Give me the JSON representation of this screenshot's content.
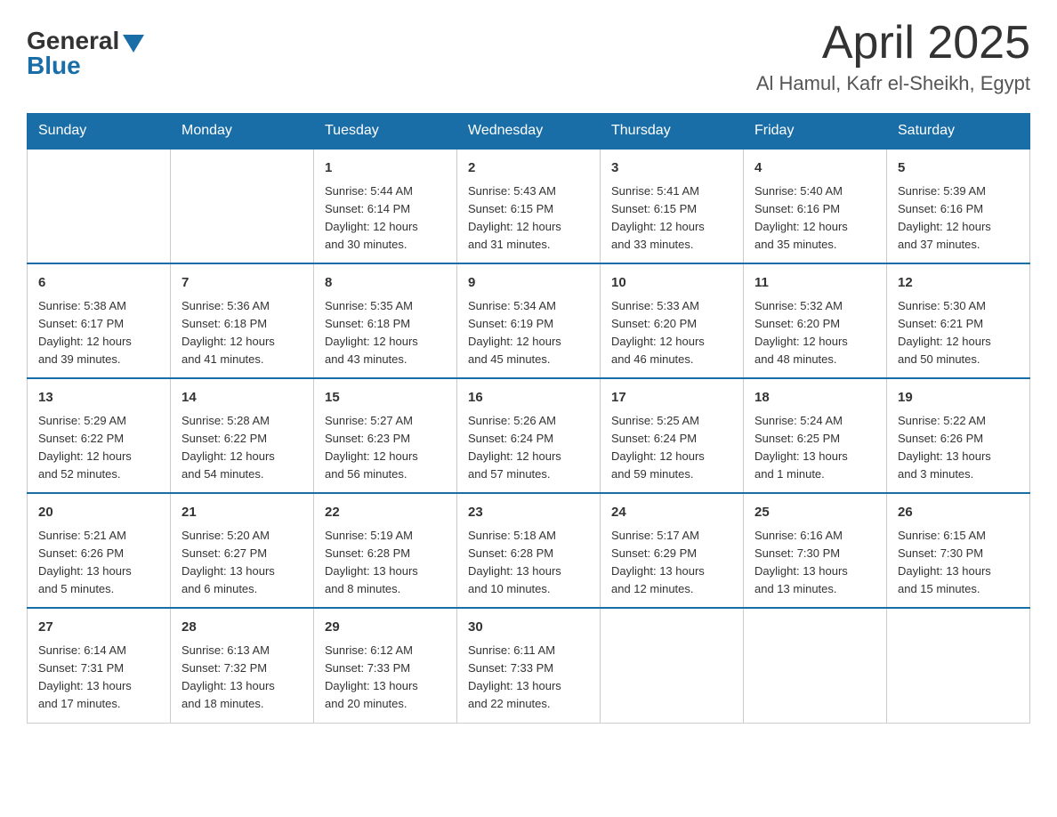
{
  "header": {
    "logo": {
      "general": "General",
      "blue": "Blue"
    },
    "title": "April 2025",
    "subtitle": "Al Hamul, Kafr el-Sheikh, Egypt"
  },
  "calendar": {
    "days_of_week": [
      "Sunday",
      "Monday",
      "Tuesday",
      "Wednesday",
      "Thursday",
      "Friday",
      "Saturday"
    ],
    "weeks": [
      [
        {
          "day": "",
          "info": ""
        },
        {
          "day": "",
          "info": ""
        },
        {
          "day": "1",
          "info": "Sunrise: 5:44 AM\nSunset: 6:14 PM\nDaylight: 12 hours\nand 30 minutes."
        },
        {
          "day": "2",
          "info": "Sunrise: 5:43 AM\nSunset: 6:15 PM\nDaylight: 12 hours\nand 31 minutes."
        },
        {
          "day": "3",
          "info": "Sunrise: 5:41 AM\nSunset: 6:15 PM\nDaylight: 12 hours\nand 33 minutes."
        },
        {
          "day": "4",
          "info": "Sunrise: 5:40 AM\nSunset: 6:16 PM\nDaylight: 12 hours\nand 35 minutes."
        },
        {
          "day": "5",
          "info": "Sunrise: 5:39 AM\nSunset: 6:16 PM\nDaylight: 12 hours\nand 37 minutes."
        }
      ],
      [
        {
          "day": "6",
          "info": "Sunrise: 5:38 AM\nSunset: 6:17 PM\nDaylight: 12 hours\nand 39 minutes."
        },
        {
          "day": "7",
          "info": "Sunrise: 5:36 AM\nSunset: 6:18 PM\nDaylight: 12 hours\nand 41 minutes."
        },
        {
          "day": "8",
          "info": "Sunrise: 5:35 AM\nSunset: 6:18 PM\nDaylight: 12 hours\nand 43 minutes."
        },
        {
          "day": "9",
          "info": "Sunrise: 5:34 AM\nSunset: 6:19 PM\nDaylight: 12 hours\nand 45 minutes."
        },
        {
          "day": "10",
          "info": "Sunrise: 5:33 AM\nSunset: 6:20 PM\nDaylight: 12 hours\nand 46 minutes."
        },
        {
          "day": "11",
          "info": "Sunrise: 5:32 AM\nSunset: 6:20 PM\nDaylight: 12 hours\nand 48 minutes."
        },
        {
          "day": "12",
          "info": "Sunrise: 5:30 AM\nSunset: 6:21 PM\nDaylight: 12 hours\nand 50 minutes."
        }
      ],
      [
        {
          "day": "13",
          "info": "Sunrise: 5:29 AM\nSunset: 6:22 PM\nDaylight: 12 hours\nand 52 minutes."
        },
        {
          "day": "14",
          "info": "Sunrise: 5:28 AM\nSunset: 6:22 PM\nDaylight: 12 hours\nand 54 minutes."
        },
        {
          "day": "15",
          "info": "Sunrise: 5:27 AM\nSunset: 6:23 PM\nDaylight: 12 hours\nand 56 minutes."
        },
        {
          "day": "16",
          "info": "Sunrise: 5:26 AM\nSunset: 6:24 PM\nDaylight: 12 hours\nand 57 minutes."
        },
        {
          "day": "17",
          "info": "Sunrise: 5:25 AM\nSunset: 6:24 PM\nDaylight: 12 hours\nand 59 minutes."
        },
        {
          "day": "18",
          "info": "Sunrise: 5:24 AM\nSunset: 6:25 PM\nDaylight: 13 hours\nand 1 minute."
        },
        {
          "day": "19",
          "info": "Sunrise: 5:22 AM\nSunset: 6:26 PM\nDaylight: 13 hours\nand 3 minutes."
        }
      ],
      [
        {
          "day": "20",
          "info": "Sunrise: 5:21 AM\nSunset: 6:26 PM\nDaylight: 13 hours\nand 5 minutes."
        },
        {
          "day": "21",
          "info": "Sunrise: 5:20 AM\nSunset: 6:27 PM\nDaylight: 13 hours\nand 6 minutes."
        },
        {
          "day": "22",
          "info": "Sunrise: 5:19 AM\nSunset: 6:28 PM\nDaylight: 13 hours\nand 8 minutes."
        },
        {
          "day": "23",
          "info": "Sunrise: 5:18 AM\nSunset: 6:28 PM\nDaylight: 13 hours\nand 10 minutes."
        },
        {
          "day": "24",
          "info": "Sunrise: 5:17 AM\nSunset: 6:29 PM\nDaylight: 13 hours\nand 12 minutes."
        },
        {
          "day": "25",
          "info": "Sunrise: 6:16 AM\nSunset: 7:30 PM\nDaylight: 13 hours\nand 13 minutes."
        },
        {
          "day": "26",
          "info": "Sunrise: 6:15 AM\nSunset: 7:30 PM\nDaylight: 13 hours\nand 15 minutes."
        }
      ],
      [
        {
          "day": "27",
          "info": "Sunrise: 6:14 AM\nSunset: 7:31 PM\nDaylight: 13 hours\nand 17 minutes."
        },
        {
          "day": "28",
          "info": "Sunrise: 6:13 AM\nSunset: 7:32 PM\nDaylight: 13 hours\nand 18 minutes."
        },
        {
          "day": "29",
          "info": "Sunrise: 6:12 AM\nSunset: 7:33 PM\nDaylight: 13 hours\nand 20 minutes."
        },
        {
          "day": "30",
          "info": "Sunrise: 6:11 AM\nSunset: 7:33 PM\nDaylight: 13 hours\nand 22 minutes."
        },
        {
          "day": "",
          "info": ""
        },
        {
          "day": "",
          "info": ""
        },
        {
          "day": "",
          "info": ""
        }
      ]
    ]
  }
}
